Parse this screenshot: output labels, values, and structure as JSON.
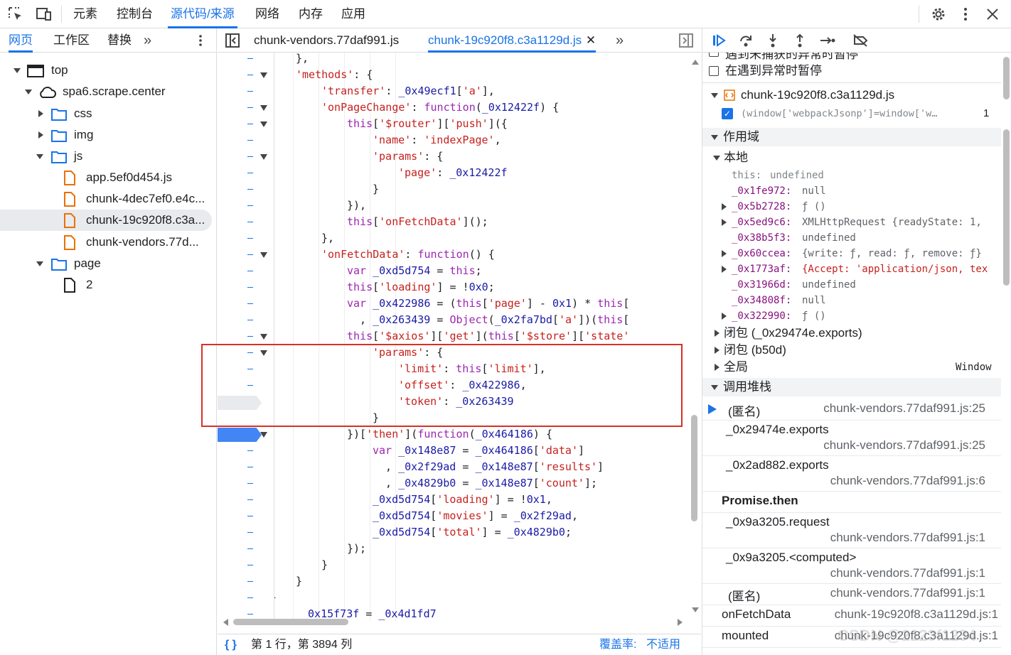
{
  "topbar": {
    "tabs": [
      "元素",
      "控制台",
      "源代码/来源",
      "网络",
      "内存",
      "应用"
    ],
    "active_tab": "源代码/来源"
  },
  "left": {
    "tabs": [
      "网页",
      "工作区",
      "替换"
    ],
    "tree": {
      "top": "top",
      "domain": "spa6.scrape.center",
      "css": "css",
      "img": "img",
      "js": "js",
      "files": [
        "app.5ef0d454.js",
        "chunk-4dec7ef0.e4c...",
        "chunk-19c920f8.c3a...",
        "chunk-vendors.77d..."
      ],
      "page": "page",
      "page_item": "2"
    }
  },
  "editor": {
    "tabs": [
      "chunk-vendors.77daf991.js",
      "chunk-19c920f8.c3a1129d.js"
    ],
    "status": {
      "position": "第 1 行，第 3894 列",
      "coverage_label": "覆盖率:",
      "coverage_value": "不适用"
    }
  },
  "right": {
    "pause_uncaught": "遇到未捕获的异常时暂停",
    "pause_caught": "在遇到异常时暂停",
    "bp_file": "chunk-19c920f8.c3a1129d.js",
    "bp_code": "(window['webpackJsonp']=window['w…",
    "bp_line": "1",
    "scope": {
      "title": "作用域",
      "local": "本地",
      "this_key": "this:",
      "this_val": "undefined",
      "vars": [
        {
          "k": "_0x1fe972:",
          "v": "null"
        },
        {
          "k": "_0x5b2728:",
          "v": "ƒ ()"
        },
        {
          "k": "_0x5ed9c6:",
          "v": "XMLHttpRequest  {readyState: 1,"
        },
        {
          "k": "_0x38b5f3:",
          "v": "undefined"
        },
        {
          "k": "_0x60ccea:",
          "v": "{write: ƒ, read: ƒ, remove: ƒ}"
        },
        {
          "k": "_0x1773af:",
          "v": "{Accept: 'application/json, tex"
        },
        {
          "k": "_0x31966d:",
          "v": "undefined"
        },
        {
          "k": "_0x34808f:",
          "v": "null"
        },
        {
          "k": "_0x322990:",
          "v": "ƒ ()"
        }
      ],
      "closure1": "闭包 (_0x29474e.exports)",
      "closure2": "闭包 (b50d)",
      "global": "全局",
      "global_val": "Window"
    },
    "callstack": {
      "title": "调用堆栈",
      "frames": [
        {
          "name": "(匿名)",
          "loc": "chunk-vendors.77daf991.js:25"
        },
        {
          "name": "_0x29474e.exports",
          "loc": "chunk-vendors.77daf991.js:25"
        },
        {
          "name": "_0x2ad882.exports",
          "loc": "chunk-vendors.77daf991.js:6"
        },
        {
          "name": "Promise.then",
          "loc": ""
        },
        {
          "name": "_0x9a3205.request",
          "loc": "chunk-vendors.77daf991.js:1"
        },
        {
          "name": "_0x9a3205.<computed>",
          "loc": "chunk-vendors.77daf991.js:1"
        },
        {
          "name": "(匿名)",
          "loc": "chunk-vendors.77daf991.js:1"
        },
        {
          "name": "onFetchData",
          "loc": "chunk-19c920f8.c3a1129d.js:1"
        },
        {
          "name": "mounted",
          "loc": "chunk-19c920f8.c3a1129d.js:1"
        }
      ]
    },
    "watermark": "CSDN @2123f1234"
  },
  "code_lines": [
    "},",
    "'methods': {",
    "'transfer': _0x49ecf1['a'],",
    "'onPageChange': function(_0x12422f) {",
    "this['$router']['push']({",
    "'name': 'indexPage',",
    "'params': {",
    "'page': _0x12422f",
    "}",
    "}),",
    "this['onFetchData']();",
    "},",
    "'onFetchData': function() {",
    "var _0xd5d754 = this;",
    "this['loading'] = !0x0;",
    "var _0x422986 = (this['page'] - 0x1) * this['",
    ", _0x263439 = Object(_0x2fa7bd['a'])(this['",
    "this['$axios']['get'](this['$store']['state'",
    "'params': {",
    "'limit': this['limit'],",
    "'offset': _0x422986,",
    "'token': _0x263439",
    "}",
    "})['then'](function(_0x464186) {",
    "var _0x148e87 = _0x464186['data']",
    ", _0x2f29ad = _0x148e87['results']",
    ", _0x4829b0 = _0x148e87['count'];",
    "_0xd5d754['loading'] = !0x1,",
    "_0xd5d754['movies'] = _0x2f29ad,",
    "_0xd5d754['total'] = _0x4829b0;",
    "});",
    "}",
    "}",
    "}",
    "_0x15f73f = _0x4d1fd7"
  ]
}
